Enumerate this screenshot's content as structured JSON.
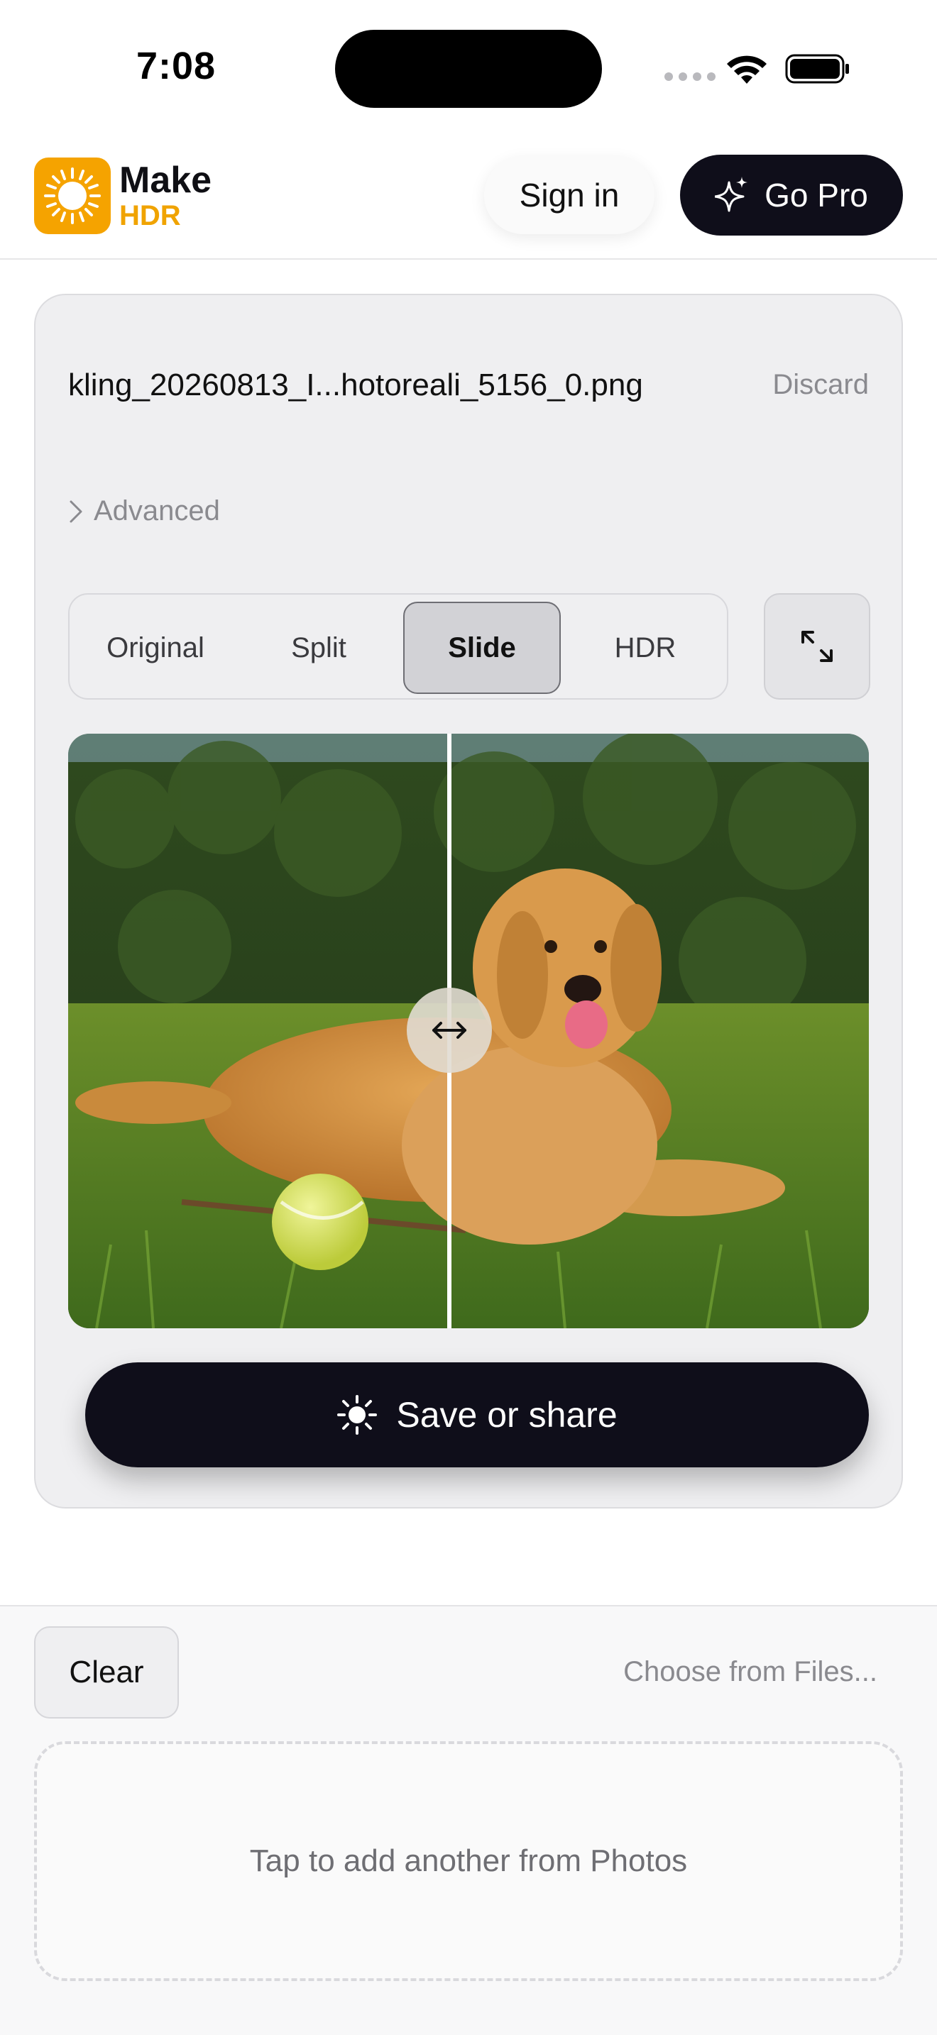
{
  "status_bar": {
    "time": "7:08",
    "icons": [
      "cellular-dots-icon",
      "wifi-icon",
      "battery-icon"
    ]
  },
  "header": {
    "logo": {
      "icon": "sun-icon",
      "word1": "Make",
      "word2": "HDR"
    },
    "sign_in_label": "Sign in",
    "go_pro": {
      "label": "Go Pro",
      "icon": "sparkle-icon"
    }
  },
  "file_card": {
    "filename": "kling_20260813_I...hotoreali_5156_0.png",
    "discard_label": "Discard",
    "advanced": {
      "label": "Advanced",
      "icon": "chevron-right-icon",
      "expanded": false
    },
    "view_modes": [
      {
        "label": "Original",
        "selected": false
      },
      {
        "label": "Split",
        "selected": false
      },
      {
        "label": "Slide",
        "selected": true
      },
      {
        "label": "HDR",
        "selected": false
      }
    ],
    "expand_icon": "expand-arrows-icon",
    "preview": {
      "slider_position": 0.476,
      "handle_icon": "left-right-arrow-icon"
    },
    "save_button": {
      "label": "Save or share",
      "icon": "sun-icon"
    }
  },
  "bottom": {
    "clear_label": "Clear",
    "choose_files_label": "Choose from Files...",
    "dropzone_label": "Tap to add another from Photos"
  },
  "colors": {
    "accent_orange": "#f5a300",
    "dark_button": "#0f0e1a",
    "card_background": "#efeff1",
    "muted_text": "#8a8a8f"
  }
}
